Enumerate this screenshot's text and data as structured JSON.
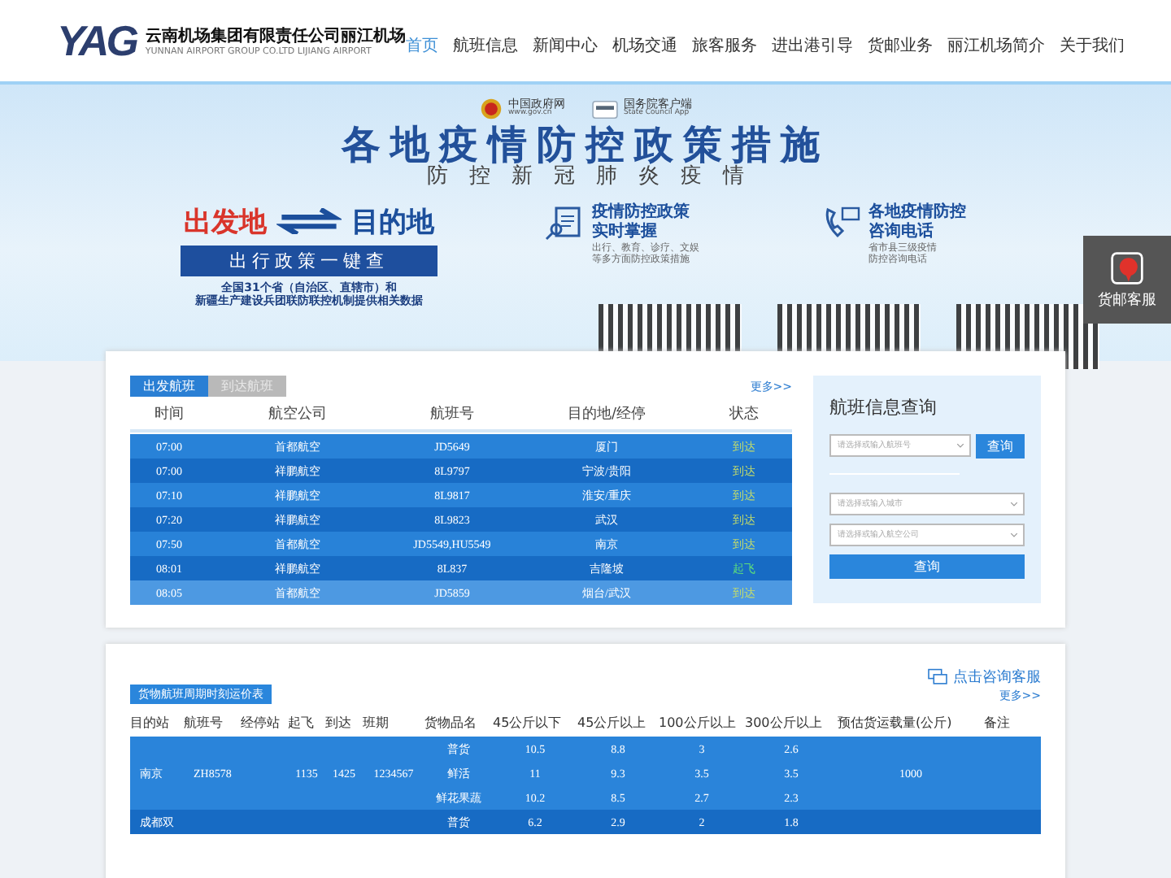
{
  "header": {
    "logo_text": "YAG",
    "title": "云南机场集团有限责任公司丽江机场",
    "subtitle": "YUNNAN AIRPORT GROUP CO.LTD LIJIANG AIRPORT",
    "nav": [
      {
        "label": "首页",
        "selected": true
      },
      {
        "label": "航班信息",
        "selected": false
      },
      {
        "label": "新闻中心",
        "selected": false
      },
      {
        "label": "机场交通",
        "selected": false
      },
      {
        "label": "旅客服务",
        "selected": false
      },
      {
        "label": "进出港引导",
        "selected": false
      },
      {
        "label": "货邮业务",
        "selected": false
      },
      {
        "label": "丽江机场简介",
        "selected": false
      },
      {
        "label": "关于我们",
        "selected": false
      }
    ]
  },
  "banner": {
    "gov_site": "中国政府网",
    "gov_url": "www.gov.cn",
    "app_name": "国务院客户端",
    "app_en": "State Council App",
    "headline": "各地疫情防控政策措施",
    "subline": "防　控　新　冠　肺　炎　疫　情",
    "origin": "出发地",
    "destination": "目的地",
    "cta": "出行政策一键查",
    "source_lines": [
      "全国31个省（自治区、直辖市）和",
      "新疆生产建设兵团联防联控机制提供相关数据"
    ],
    "features": [
      {
        "kind": "policy",
        "title_lines": [
          "疫情防控政策",
          "实时掌握"
        ],
        "desc_lines": [
          "出行、教育、诊疗、文娱",
          "等多方面防控政策措施"
        ]
      },
      {
        "kind": "phone",
        "title_lines": [
          "各地疫情防控",
          "咨询电话"
        ],
        "desc_lines": [
          "省市县三级疫情",
          "防控咨询电话"
        ]
      }
    ]
  },
  "side_button": {
    "label": "货邮客服"
  },
  "flights": {
    "tabs": [
      {
        "label": "出发航班",
        "selected": true
      },
      {
        "label": "到达航班",
        "selected": false
      }
    ],
    "more": "更多>>",
    "columns": [
      "时间",
      "航空公司",
      "航班号",
      "目的地/经停",
      "状态"
    ],
    "rows": [
      {
        "time": "07:00",
        "airline": "首都航空",
        "flight": "JD5649",
        "destination": "厦门",
        "status": "到达",
        "kind": "arrived",
        "highlighted": false
      },
      {
        "time": "07:00",
        "airline": "祥鹏航空",
        "flight": "8L9797",
        "destination": "宁波/贵阳",
        "status": "到达",
        "kind": "arrived",
        "highlighted": false
      },
      {
        "time": "07:10",
        "airline": "祥鹏航空",
        "flight": "8L9817",
        "destination": "淮安/重庆",
        "status": "到达",
        "kind": "arrived",
        "highlighted": false
      },
      {
        "time": "07:20",
        "airline": "祥鹏航空",
        "flight": "8L9823",
        "destination": "武汉",
        "status": "到达",
        "kind": "arrived",
        "highlighted": false
      },
      {
        "time": "07:50",
        "airline": "首都航空",
        "flight": "JD5549,HU5549",
        "destination": "南京",
        "status": "到达",
        "kind": "arrived",
        "highlighted": false
      },
      {
        "time": "08:01",
        "airline": "祥鹏航空",
        "flight": "8L837",
        "destination": "吉隆坡",
        "status": "起飞",
        "kind": "departed",
        "highlighted": false
      },
      {
        "time": "08:05",
        "airline": "首都航空",
        "flight": "JD5859",
        "destination": "烟台/武汉",
        "status": "到达",
        "kind": "arrived",
        "highlighted": true
      }
    ]
  },
  "search": {
    "title": "航班信息查询",
    "flight_placeholder": "请选择或输入航班号",
    "flight_button": "查询",
    "city_placeholder": "请选择或输入城市",
    "airline_placeholder": "请选择或输入航空公司",
    "search_button": "查询"
  },
  "cargo": {
    "consult": "点击咨询客服",
    "title": "货物航班周期时刻运价表",
    "more": "更多>>",
    "columns": [
      "目的站",
      "航班号",
      "经停站",
      "起飞",
      "到达",
      "班期",
      "货物品名",
      "45公斤以下",
      "45公斤以上",
      "100公斤以上",
      "300公斤以上",
      "预估货运载量(公斤)",
      "备注"
    ],
    "groups": [
      {
        "destination": "南京",
        "flight": "ZH8578",
        "departure": "1135",
        "arrival": "1425",
        "schedule": "1234567",
        "capacity": "1000",
        "items": [
          {
            "goods": "普货",
            "rates": [
              "10.5",
              "8.8",
              "3",
              "2.6"
            ]
          },
          {
            "goods": "鲜活",
            "rates": [
              "11",
              "9.3",
              "3.5",
              "3.5"
            ]
          },
          {
            "goods": "鲜花果蔬",
            "rates": [
              "10.2",
              "8.5",
              "2.7",
              "2.3"
            ]
          }
        ]
      },
      {
        "destination": "成都双",
        "items": [
          {
            "goods": "普货",
            "rates": [
              "6.2",
              "2.9",
              "2",
              "1.8"
            ]
          }
        ]
      }
    ]
  }
}
